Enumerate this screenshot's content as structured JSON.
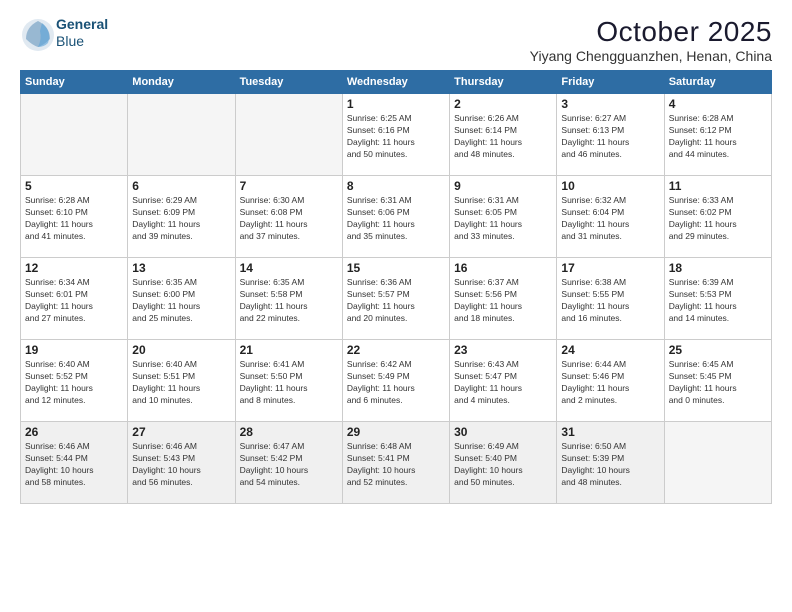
{
  "header": {
    "logo_line1": "General",
    "logo_line2": "Blue",
    "month": "October 2025",
    "location": "Yiyang Chengguanzhen, Henan, China"
  },
  "weekdays": [
    "Sunday",
    "Monday",
    "Tuesday",
    "Wednesday",
    "Thursday",
    "Friday",
    "Saturday"
  ],
  "weeks": [
    [
      {
        "day": "",
        "info": ""
      },
      {
        "day": "",
        "info": ""
      },
      {
        "day": "",
        "info": ""
      },
      {
        "day": "1",
        "info": "Sunrise: 6:25 AM\nSunset: 6:16 PM\nDaylight: 11 hours\nand 50 minutes."
      },
      {
        "day": "2",
        "info": "Sunrise: 6:26 AM\nSunset: 6:14 PM\nDaylight: 11 hours\nand 48 minutes."
      },
      {
        "day": "3",
        "info": "Sunrise: 6:27 AM\nSunset: 6:13 PM\nDaylight: 11 hours\nand 46 minutes."
      },
      {
        "day": "4",
        "info": "Sunrise: 6:28 AM\nSunset: 6:12 PM\nDaylight: 11 hours\nand 44 minutes."
      }
    ],
    [
      {
        "day": "5",
        "info": "Sunrise: 6:28 AM\nSunset: 6:10 PM\nDaylight: 11 hours\nand 41 minutes."
      },
      {
        "day": "6",
        "info": "Sunrise: 6:29 AM\nSunset: 6:09 PM\nDaylight: 11 hours\nand 39 minutes."
      },
      {
        "day": "7",
        "info": "Sunrise: 6:30 AM\nSunset: 6:08 PM\nDaylight: 11 hours\nand 37 minutes."
      },
      {
        "day": "8",
        "info": "Sunrise: 6:31 AM\nSunset: 6:06 PM\nDaylight: 11 hours\nand 35 minutes."
      },
      {
        "day": "9",
        "info": "Sunrise: 6:31 AM\nSunset: 6:05 PM\nDaylight: 11 hours\nand 33 minutes."
      },
      {
        "day": "10",
        "info": "Sunrise: 6:32 AM\nSunset: 6:04 PM\nDaylight: 11 hours\nand 31 minutes."
      },
      {
        "day": "11",
        "info": "Sunrise: 6:33 AM\nSunset: 6:02 PM\nDaylight: 11 hours\nand 29 minutes."
      }
    ],
    [
      {
        "day": "12",
        "info": "Sunrise: 6:34 AM\nSunset: 6:01 PM\nDaylight: 11 hours\nand 27 minutes."
      },
      {
        "day": "13",
        "info": "Sunrise: 6:35 AM\nSunset: 6:00 PM\nDaylight: 11 hours\nand 25 minutes."
      },
      {
        "day": "14",
        "info": "Sunrise: 6:35 AM\nSunset: 5:58 PM\nDaylight: 11 hours\nand 22 minutes."
      },
      {
        "day": "15",
        "info": "Sunrise: 6:36 AM\nSunset: 5:57 PM\nDaylight: 11 hours\nand 20 minutes."
      },
      {
        "day": "16",
        "info": "Sunrise: 6:37 AM\nSunset: 5:56 PM\nDaylight: 11 hours\nand 18 minutes."
      },
      {
        "day": "17",
        "info": "Sunrise: 6:38 AM\nSunset: 5:55 PM\nDaylight: 11 hours\nand 16 minutes."
      },
      {
        "day": "18",
        "info": "Sunrise: 6:39 AM\nSunset: 5:53 PM\nDaylight: 11 hours\nand 14 minutes."
      }
    ],
    [
      {
        "day": "19",
        "info": "Sunrise: 6:40 AM\nSunset: 5:52 PM\nDaylight: 11 hours\nand 12 minutes."
      },
      {
        "day": "20",
        "info": "Sunrise: 6:40 AM\nSunset: 5:51 PM\nDaylight: 11 hours\nand 10 minutes."
      },
      {
        "day": "21",
        "info": "Sunrise: 6:41 AM\nSunset: 5:50 PM\nDaylight: 11 hours\nand 8 minutes."
      },
      {
        "day": "22",
        "info": "Sunrise: 6:42 AM\nSunset: 5:49 PM\nDaylight: 11 hours\nand 6 minutes."
      },
      {
        "day": "23",
        "info": "Sunrise: 6:43 AM\nSunset: 5:47 PM\nDaylight: 11 hours\nand 4 minutes."
      },
      {
        "day": "24",
        "info": "Sunrise: 6:44 AM\nSunset: 5:46 PM\nDaylight: 11 hours\nand 2 minutes."
      },
      {
        "day": "25",
        "info": "Sunrise: 6:45 AM\nSunset: 5:45 PM\nDaylight: 11 hours\nand 0 minutes."
      }
    ],
    [
      {
        "day": "26",
        "info": "Sunrise: 6:46 AM\nSunset: 5:44 PM\nDaylight: 10 hours\nand 58 minutes."
      },
      {
        "day": "27",
        "info": "Sunrise: 6:46 AM\nSunset: 5:43 PM\nDaylight: 10 hours\nand 56 minutes."
      },
      {
        "day": "28",
        "info": "Sunrise: 6:47 AM\nSunset: 5:42 PM\nDaylight: 10 hours\nand 54 minutes."
      },
      {
        "day": "29",
        "info": "Sunrise: 6:48 AM\nSunset: 5:41 PM\nDaylight: 10 hours\nand 52 minutes."
      },
      {
        "day": "30",
        "info": "Sunrise: 6:49 AM\nSunset: 5:40 PM\nDaylight: 10 hours\nand 50 minutes."
      },
      {
        "day": "31",
        "info": "Sunrise: 6:50 AM\nSunset: 5:39 PM\nDaylight: 10 hours\nand 48 minutes."
      },
      {
        "day": "",
        "info": ""
      }
    ]
  ]
}
